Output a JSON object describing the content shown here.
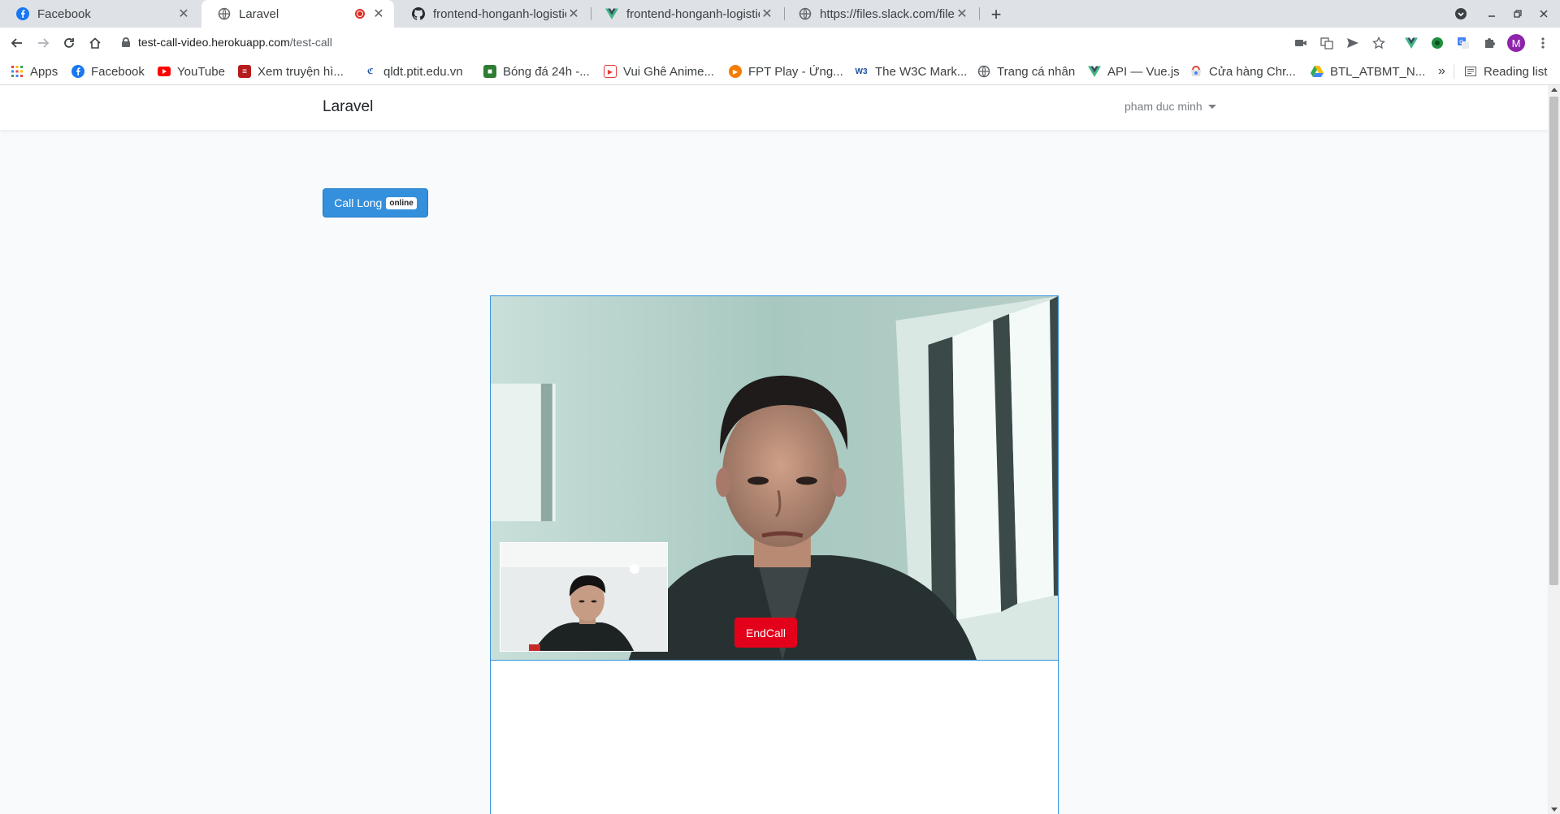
{
  "browser": {
    "tabs": [
      {
        "title": "Facebook",
        "icon": "facebook-icon",
        "active": false
      },
      {
        "title": "Laravel",
        "icon": "globe-icon",
        "active": true,
        "recording": true
      },
      {
        "title": "frontend-honganh-logistic",
        "icon": "github-icon",
        "active": false
      },
      {
        "title": "frontend-honganh-logistic",
        "icon": "vue-icon",
        "active": false
      },
      {
        "title": "https://files.slack.com/files",
        "icon": "globe-icon",
        "active": false
      }
    ],
    "new_tab": "+",
    "address": {
      "host": "test-call-video.herokuapp.com",
      "path": "/test-call"
    },
    "profile_initial": "M",
    "bookmarks": [
      {
        "label": "Apps",
        "icon": "apps-grid-icon"
      },
      {
        "label": "Facebook",
        "icon": "facebook-icon"
      },
      {
        "label": "YouTube",
        "icon": "youtube-icon"
      },
      {
        "label": "Xem truyện hì...",
        "icon": "comic-icon"
      },
      {
        "label": "qldt.ptit.edu.vn",
        "icon": "ptit-icon"
      },
      {
        "label": "Bóng đá 24h -...",
        "icon": "soccer-icon"
      },
      {
        "label": "Vui Ghê Anime...",
        "icon": "anime-icon"
      },
      {
        "label": "FPT Play - Ứng...",
        "icon": "fptplay-icon"
      },
      {
        "label": "The W3C Mark...",
        "icon": "w3c-icon"
      },
      {
        "label": "Trang cá nhân",
        "icon": "globe-icon"
      },
      {
        "label": "API — Vue.js",
        "icon": "vue-icon"
      },
      {
        "label": "Cửa hàng Chr...",
        "icon": "webstore-icon"
      },
      {
        "label": "BTL_ATBMT_N...",
        "icon": "google-drive-icon"
      }
    ],
    "bookmarks_overflow": "»",
    "reading_list": "Reading list"
  },
  "app": {
    "brand": "Laravel",
    "user_name": "pham duc minh",
    "call_button": {
      "label": "Call Long",
      "badge": "online"
    },
    "end_call_label": "EndCall"
  },
  "colors": {
    "primary": "#3490dc",
    "danger": "#e3001b",
    "page_background": "#f8fafc"
  }
}
